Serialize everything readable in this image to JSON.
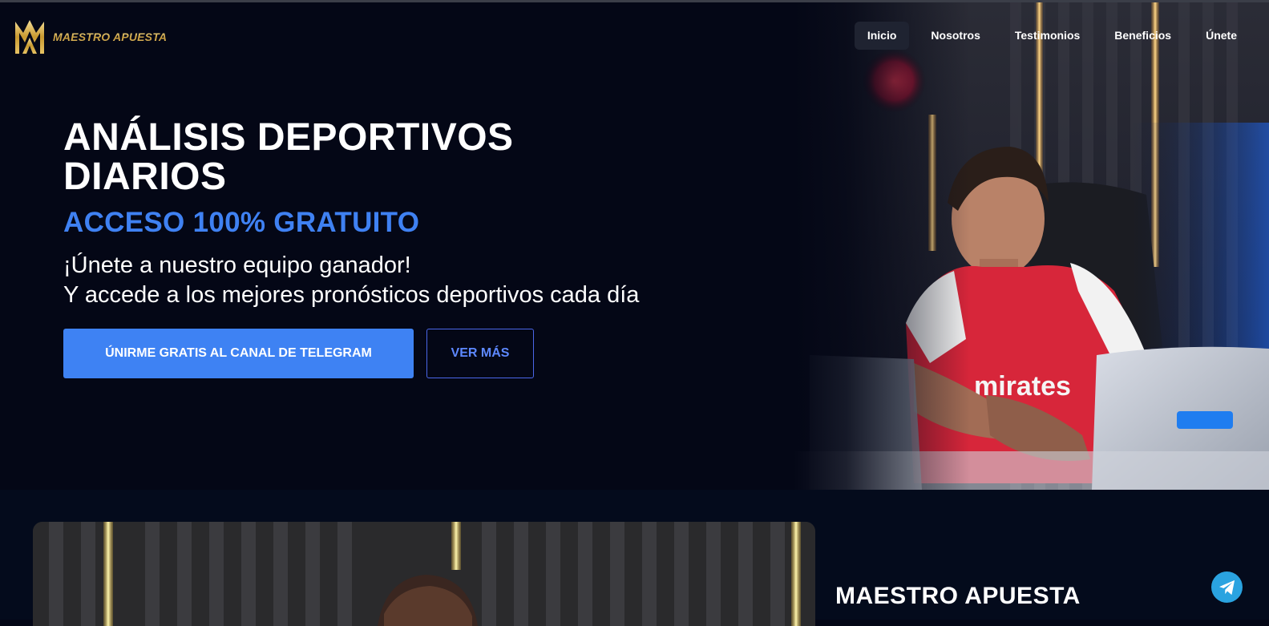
{
  "brand": {
    "name": "MAESTRO APUESTA",
    "logo_icon": "crown-monogram-logo",
    "gold": "#d9b65a"
  },
  "nav": {
    "items": [
      {
        "label": "Inicio",
        "active": true
      },
      {
        "label": "Nosotros",
        "active": false
      },
      {
        "label": "Testimonios",
        "active": false
      },
      {
        "label": "Beneficios",
        "active": false
      },
      {
        "label": "Únete",
        "active": false
      }
    ]
  },
  "hero": {
    "title_line1": "ANÁLISIS DEPORTIVOS",
    "title_line2": "DIARIOS",
    "subtitle": "ACCESO 100% GRATUITO",
    "text_line1": "¡Únete a nuestro equipo ganador!",
    "text_line2": "Y accede a los mejores pronósticos deportivos cada día",
    "primary_button": "ÚNIRME GRATIS AL CANAL DE TELEGRAM",
    "secondary_button": "VER MÁS",
    "photo": "man-in-arsenal-jersey-at-desk"
  },
  "about": {
    "title": "MAESTRO APUESTA",
    "photo": "studio-portrait"
  },
  "floating": {
    "icon": "telegram-icon"
  },
  "colors": {
    "background": "#040716",
    "accent_blue": "#3e82f3",
    "outline_blue": "#4a66e8",
    "telegram": "#2aa3e0"
  }
}
